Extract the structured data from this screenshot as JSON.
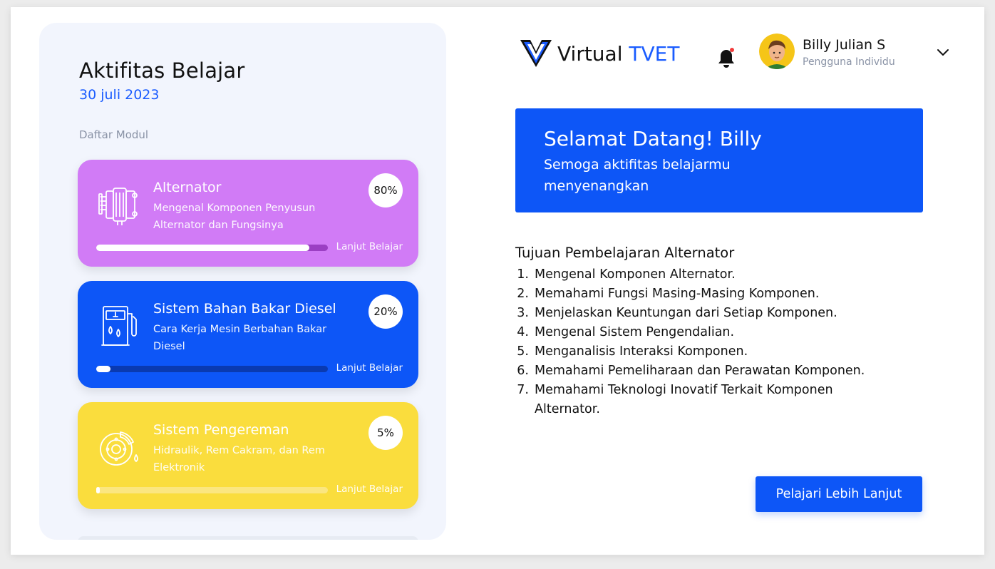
{
  "app": {
    "logo_prefix": "Virtual",
    "logo_accent": "TVET"
  },
  "user": {
    "name": "Billy Julian S",
    "role": "Pengguna Individu"
  },
  "activity": {
    "title": "Aktifitas Belajar",
    "date": "30 juli 2023",
    "section_label": "Daftar Modul",
    "modules": [
      {
        "title": "Alternator",
        "desc": "Mengenal Komponen Penyusun Alternator dan Fungsinya",
        "percent_label": "80%",
        "progress": 0.92,
        "action": "Lanjut Belajar",
        "color": "#d17bf6",
        "track_color": "#9b3fc3",
        "icon": "alternator-icon"
      },
      {
        "title": "Sistem Bahan Bakar Diesel",
        "desc": "Cara Kerja Mesin Berbahan Bakar Diesel",
        "percent_label": "20%",
        "progress": 0.06,
        "action": "Lanjut Belajar",
        "color": "#0d56f7",
        "track_color": "#0a3ab0",
        "icon": "fuel-pump-icon"
      },
      {
        "title": "Sistem Pengereman",
        "desc": "Hidraulik, Rem Cakram, dan Rem Elektronik",
        "percent_label": "5%",
        "progress": 0.015,
        "action": "Lanjut Belajar",
        "color": "#fadd3d",
        "track_color": "#fbe680",
        "icon": "brake-disc-icon"
      }
    ]
  },
  "welcome": {
    "title": "Selamat Datang! Billy",
    "subtitle": "Semoga aktifitas belajarmu menyenangkan"
  },
  "objectives": {
    "title": "Tujuan Pembelajaran Alternator",
    "items": [
      "Mengenal Komponen Alternator.",
      "Memahami Fungsi Masing-Masing Komponen.",
      "Menjelaskan Keuntungan dari Setiap Komponen.",
      "Mengenal Sistem Pengendalian.",
      "Menganalisis Interaksi Komponen.",
      "Memahami Pemeliharaan dan Perawatan Komponen.",
      "Memahami Teknologi Inovatif Terkait Komponen Alternator."
    ]
  },
  "cta_label": "Pelajari Lebih Lanjut",
  "colors": {
    "accent": "#1a5cff",
    "notification_dot": "#f23b3b"
  }
}
